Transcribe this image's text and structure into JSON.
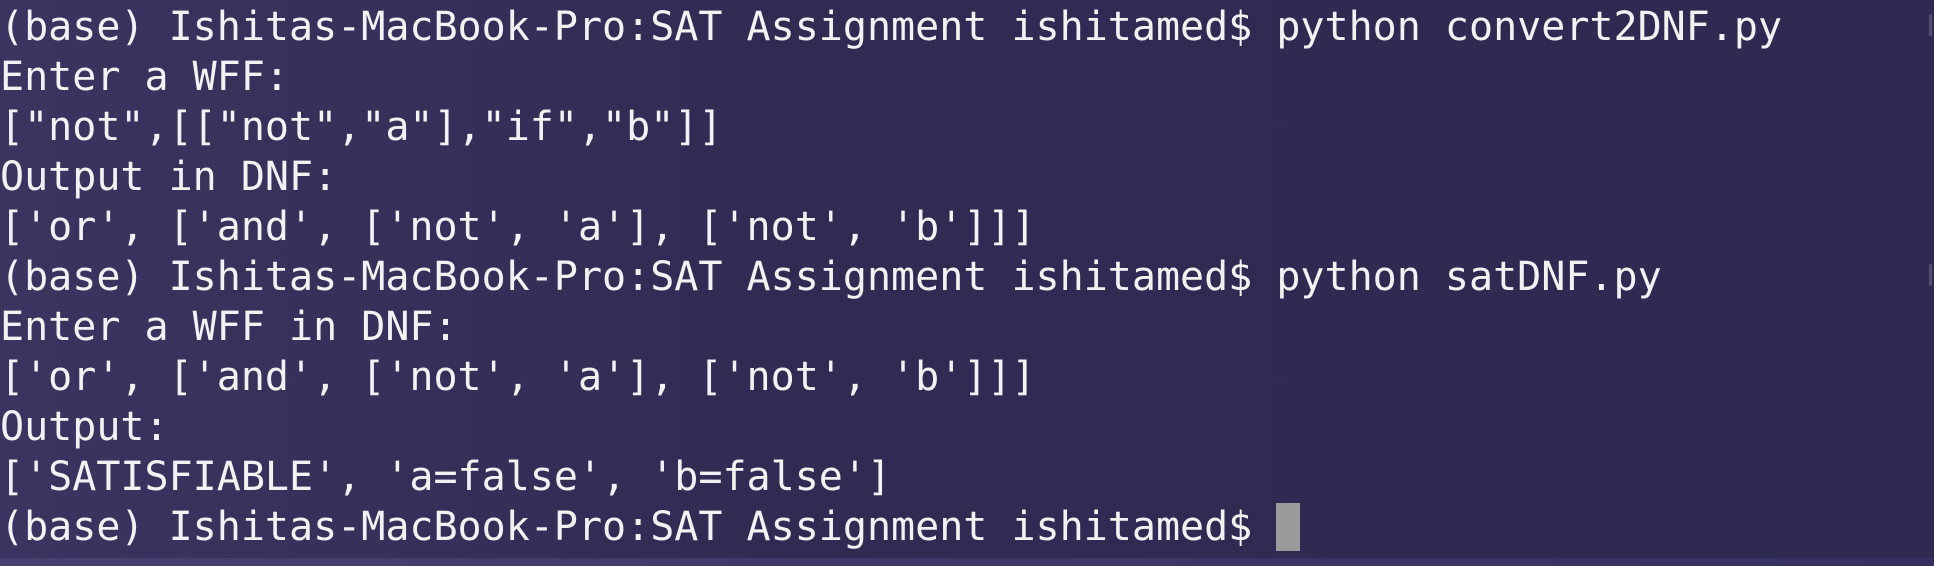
{
  "terminal": {
    "lines": [
      {
        "text": "(base) Ishitas-MacBook-Pro:SAT Assignment ishitamed$ python convert2DNF.py"
      },
      {
        "text": "Enter a WFF:"
      },
      {
        "text": "[\"not\",[[\"not\",\"a\"],\"if\",\"b\"]]"
      },
      {
        "text": "Output in DNF:"
      },
      {
        "text": "['or', ['and', ['not', 'a'], ['not', 'b']]]"
      },
      {
        "text": "(base) Ishitas-MacBook-Pro:SAT Assignment ishitamed$ python satDNF.py"
      },
      {
        "text": "Enter a WFF in DNF:"
      },
      {
        "text": "['or', ['and', ['not', 'a'], ['not', 'b']]]"
      },
      {
        "text": "Output:"
      },
      {
        "text": "['SATISFIABLE', 'a=false', 'b=false']"
      },
      {
        "text": "(base) Ishitas-MacBook-Pro:SAT Assignment ishitamed$ "
      }
    ]
  }
}
